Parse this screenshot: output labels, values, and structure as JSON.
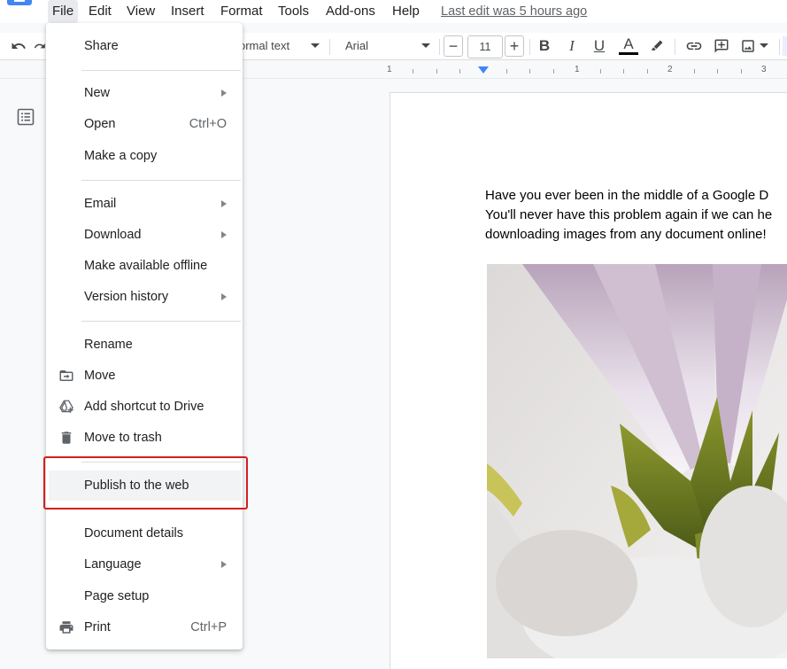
{
  "menubar": {
    "items": [
      "File",
      "Edit",
      "View",
      "Insert",
      "Format",
      "Tools",
      "Add-ons",
      "Help"
    ],
    "last_edit": "Last edit was 5 hours ago"
  },
  "toolbar": {
    "style": "ormal text",
    "font": "Arial",
    "font_size": "11",
    "minus": "−",
    "plus": "+",
    "bold": "B",
    "italic": "I",
    "underline": "U",
    "text_color_glyph": "A",
    "icons": [
      "undo-icon",
      "redo-icon",
      "highlighter-icon",
      "link-icon",
      "add-comment-icon",
      "insert-image-icon"
    ]
  },
  "ruler": {
    "marks": [
      "1",
      "1",
      "2",
      "3"
    ]
  },
  "file_menu": {
    "share": "Share",
    "new": "New",
    "open": "Open",
    "open_shortcut": "Ctrl+O",
    "make_copy": "Make a copy",
    "email": "Email",
    "download": "Download",
    "make_offline": "Make available offline",
    "version_history": "Version history",
    "rename": "Rename",
    "move": "Move",
    "add_shortcut": "Add shortcut to Drive",
    "move_to_trash": "Move to trash",
    "publish": "Publish to the web",
    "document_details": "Document details",
    "language": "Language",
    "page_setup": "Page setup",
    "print": "Print",
    "print_shortcut": "Ctrl+P"
  },
  "document": {
    "lines": [
      "Have you ever been in the middle of a Google D",
      "You'll never have this problem again if we can he",
      "downloading images from any document online!"
    ]
  },
  "colors": {
    "accent": "#4285f4",
    "highlight_border": "#d31f1f"
  }
}
